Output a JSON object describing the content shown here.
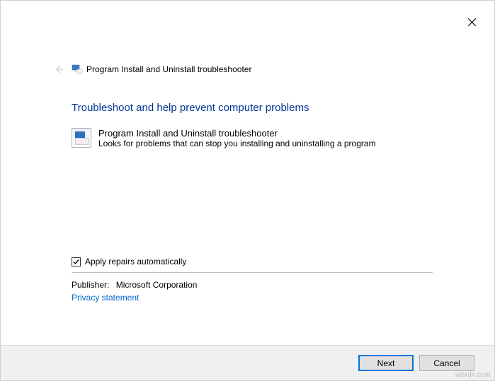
{
  "header": {
    "title": "Program Install and Uninstall troubleshooter"
  },
  "main": {
    "heading": "Troubleshoot and help prevent computer problems",
    "item": {
      "title": "Program Install and Uninstall troubleshooter",
      "description": "Looks for problems that can stop you installing and uninstalling a program"
    }
  },
  "options": {
    "apply_repairs_label": "Apply repairs automatically",
    "apply_repairs_checked": true
  },
  "publisher": {
    "label": "Publisher:",
    "value": "Microsoft Corporation"
  },
  "links": {
    "privacy": "Privacy statement"
  },
  "footer": {
    "next_label": "Next",
    "cancel_label": "Cancel"
  },
  "watermark": "wsxdn.com"
}
